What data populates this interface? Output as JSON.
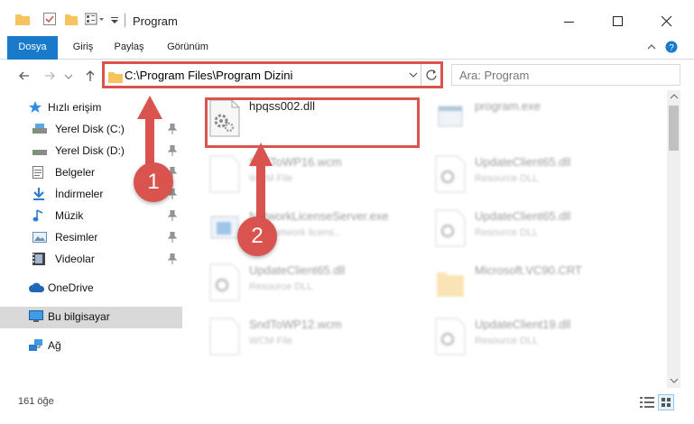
{
  "window": {
    "title": "Program",
    "minimize_glyph": "–",
    "maximize_glyph": "☐",
    "close_glyph": "✕"
  },
  "ribbon": {
    "tabs": [
      "Dosya",
      "Giriş",
      "Paylaş",
      "Görünüm"
    ]
  },
  "address": {
    "path": "C:\\Program Files\\Program Dizini",
    "search_placeholder": "Ara: Program"
  },
  "sidebar": {
    "items": [
      {
        "label": "Hızlı erişim",
        "icon": "star-icon"
      },
      {
        "label": "Yerel Disk (C:)",
        "icon": "drive-icon",
        "pinned": true
      },
      {
        "label": "Yerel Disk (D:)",
        "icon": "drive-icon",
        "pinned": true
      },
      {
        "label": "Belgeler",
        "icon": "documents-icon",
        "pinned": true
      },
      {
        "label": "İndirmeler",
        "icon": "download-icon",
        "pinned": true
      },
      {
        "label": "Müzik",
        "icon": "music-icon",
        "pinned": true
      },
      {
        "label": "Resimler",
        "icon": "pictures-icon",
        "pinned": true
      },
      {
        "label": "Videolar",
        "icon": "videos-icon",
        "pinned": true
      },
      {
        "label": "OneDrive",
        "icon": "cloud-icon"
      },
      {
        "label": "Bu bilgisayar",
        "icon": "computer-icon",
        "selected": true
      },
      {
        "label": "Ağ",
        "icon": "network-icon"
      }
    ]
  },
  "files": [
    {
      "name": "hpqss002.dll",
      "type": "",
      "icon": "dll-gear-icon",
      "highlighted": true
    },
    {
      "name": "program.exe",
      "type": "",
      "icon": "exe-icon"
    },
    {
      "name": "SndToWP16.wcm",
      "type": "WCM File",
      "icon": "file-icon"
    },
    {
      "name": "UpdateClient65.dll",
      "type": "Resource DLL",
      "icon": "dll-gear-icon"
    },
    {
      "name": "NetworkLicenseServer.exe",
      "type": "EXT network licens...",
      "icon": "exe-icon"
    },
    {
      "name": "UpdateClient65.dll",
      "type": "Resource DLL",
      "icon": "dll-gear-icon"
    },
    {
      "name": "UpdateClient65.dll",
      "type": "Resource DLL",
      "icon": "dll-gear-icon"
    },
    {
      "name": "Microsoft.VC90.CRT",
      "type": "",
      "icon": "folder-icon"
    },
    {
      "name": "SndToWP12.wcm",
      "type": "WCM File",
      "icon": "file-icon"
    },
    {
      "name": "UpdateClient19.dll",
      "type": "Resource DLL",
      "icon": "dll-gear-icon"
    }
  ],
  "status": {
    "count": "161 öğe"
  },
  "annotations": {
    "step1": "1",
    "step2": "2"
  },
  "colors": {
    "accent": "#1979ca",
    "highlight": "#d9534f",
    "selected": "#d9d9d9"
  }
}
